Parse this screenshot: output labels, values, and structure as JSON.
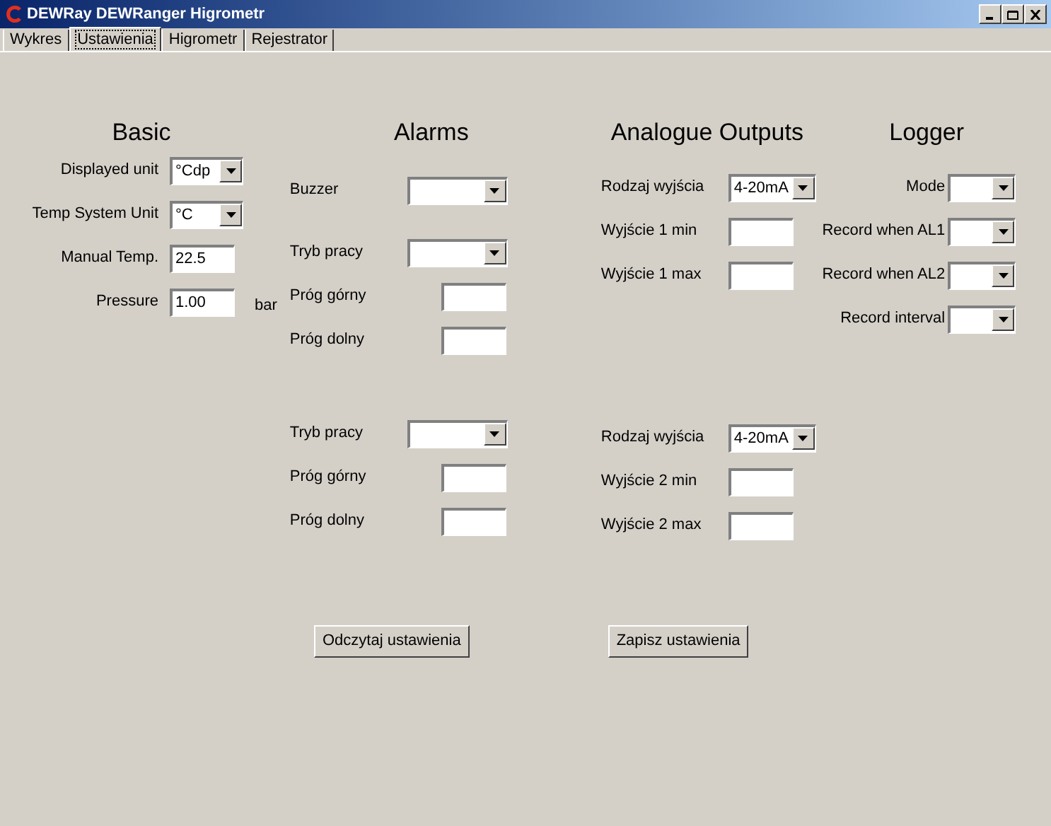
{
  "window": {
    "title": "DEWRay DEWRanger Higrometr"
  },
  "tabs": [
    {
      "label": "Wykres",
      "selected": false
    },
    {
      "label": "Ustawienia",
      "selected": true
    },
    {
      "label": "Higrometr",
      "selected": false
    },
    {
      "label": "Rejestrator",
      "selected": false
    }
  ],
  "columns": [
    {
      "title": "Basic",
      "groups": [
        [
          {
            "label": "Displayed unit",
            "kind": "combo",
            "value": "°Cdp"
          },
          {
            "label": "Temp System Unit",
            "kind": "combo",
            "value": "°C"
          },
          {
            "label": "Manual Temp.",
            "kind": "input",
            "value": "22.5"
          },
          {
            "label": "Pressure",
            "kind": "input",
            "value": "1.00",
            "unit": "bar"
          }
        ]
      ]
    },
    {
      "title": "Alarms",
      "groups": [
        [
          {
            "label": "Buzzer",
            "kind": "combo"
          }
        ],
        [
          {
            "label": "Tryb pracy",
            "kind": "combo"
          },
          {
            "label": "Próg górny",
            "kind": "input"
          },
          {
            "label": "Próg dolny",
            "kind": "input"
          }
        ],
        [
          {
            "label": "Tryb pracy",
            "kind": "combo"
          },
          {
            "label": "Próg górny",
            "kind": "input"
          },
          {
            "label": "Próg dolny",
            "kind": "input"
          }
        ]
      ]
    },
    {
      "title": "Analogue Outputs",
      "groups": [
        [
          {
            "label": "Rodzaj wyjścia",
            "kind": "combo",
            "value": "4-20mA"
          },
          {
            "label": "Wyjście 1 min",
            "kind": "input"
          },
          {
            "label": "Wyjście 1 max",
            "kind": "input"
          }
        ],
        [
          {
            "label": "Rodzaj wyjścia",
            "kind": "combo",
            "value": "4-20mA"
          },
          {
            "label": "Wyjście 2 min",
            "kind": "input"
          },
          {
            "label": "Wyjście 2 max",
            "kind": "input"
          }
        ]
      ]
    },
    {
      "title": "Logger",
      "groups": [
        [
          {
            "label": "Mode",
            "kind": "combo"
          },
          {
            "label": "Record when AL1",
            "kind": "combo"
          },
          {
            "label": "Record when AL2",
            "kind": "combo"
          },
          {
            "label": "Record interval",
            "kind": "combo"
          }
        ]
      ]
    }
  ],
  "buttons": [
    "Odczytaj ustawienia",
    "Zapisz ustawienia"
  ]
}
